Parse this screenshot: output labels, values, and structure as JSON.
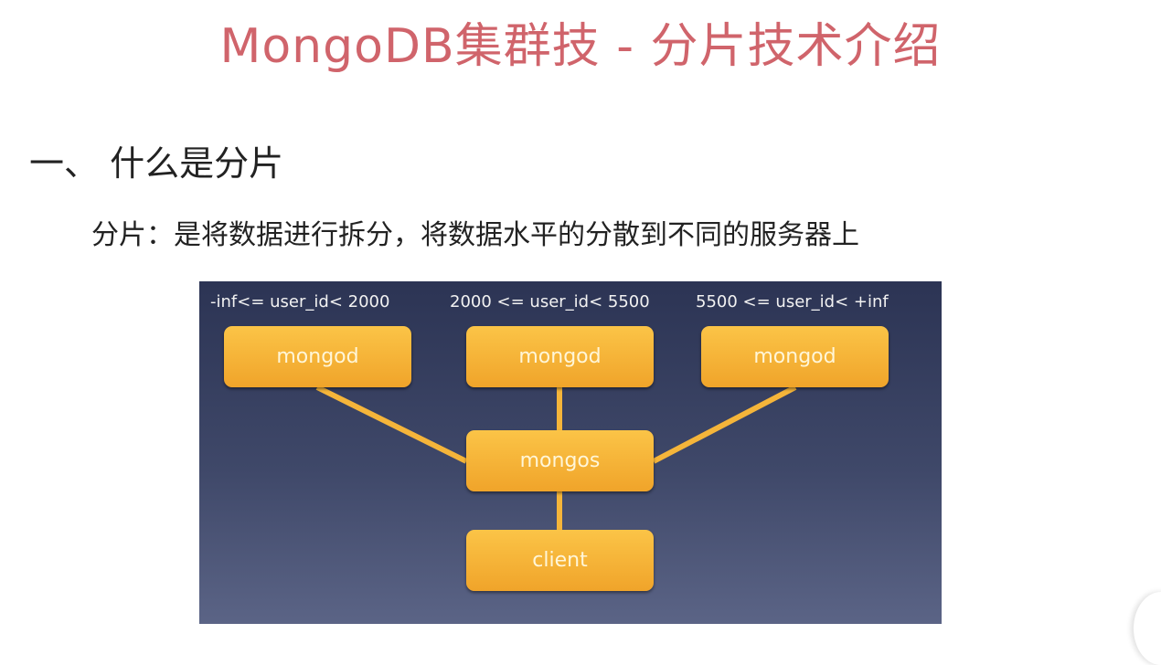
{
  "title": "MongoDB集群技 - 分片技术介绍",
  "heading": "一、 什么是分片",
  "description": "分片：是将数据进行拆分，将数据水平的分散到不同的服务器上",
  "diagram": {
    "ranges": [
      "-inf<= user_id< 2000",
      "2000 <= user_id< 5500",
      "5500 <= user_id< +inf"
    ],
    "shards": [
      "mongod",
      "mongod",
      "mongod"
    ],
    "router": "mongos",
    "client": "client"
  }
}
